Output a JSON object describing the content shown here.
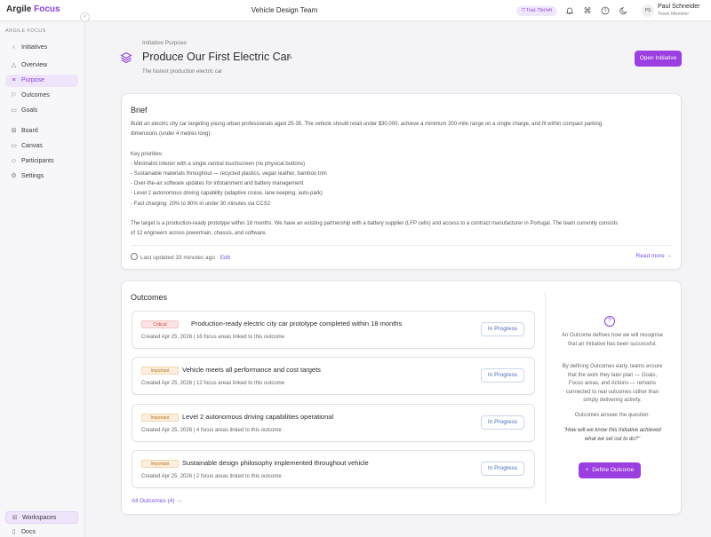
{
  "header": {
    "logo_main": "Argile",
    "logo_accent": "Focus",
    "team_title": "Vehicle Design Team",
    "trial_badge": "Trial: 79d left",
    "user_initials": "PS",
    "user_name": "Paul Schneider",
    "user_role": "Team Member"
  },
  "sidebar": {
    "heading": "ARGILE FOCUS",
    "back_label": "Initiatives",
    "items": [
      {
        "label": "Overview"
      },
      {
        "label": "Purpose"
      },
      {
        "label": "Outcomes"
      },
      {
        "label": "Goals"
      },
      {
        "label": "Board"
      },
      {
        "label": "Canvas"
      },
      {
        "label": "Participants"
      },
      {
        "label": "Settings"
      }
    ],
    "workspaces_label": "Workspaces",
    "docs_label": "Docs"
  },
  "page": {
    "crumb": "Initiative Purpose",
    "title": "Produce Our First Electric Car",
    "subtitle": "The fastest production electric car",
    "open_button": "Open Initiative"
  },
  "brief": {
    "title": "Brief",
    "lines": [
      "Build an electric city car targeting young urban professionals aged 25-35. The vehicle should retail under $30,000, achieve a minimum 200-mile range on a single charge, and fit within compact parking",
      "dimensions (under 4 metres long).",
      "",
      "Key priorities:",
      "- Minimalist interior with a single central touchscreen (no physical buttons)",
      "- Sustainable materials throughout — recycled plastics, vegan leather, bamboo trim",
      "- Over-the-air software updates for infotainment and battery management",
      "- Level 2 autonomous driving capability (adaptive cruise, lane keeping, auto-park)",
      "- Fast charging: 20% to 80% in under 30 minutes via CCS2",
      "",
      "The target is a production-ready prototype within 18 months. We have an existing partnership with a battery supplier (LFP cells) and access to a contract manufacturer in Portugal. The team currently consists",
      "of 12 engineers across powertrain, chassis, and software."
    ],
    "last_updated": "Last updated 33 minutes ago",
    "edit_label": "Edit",
    "read_more": "Read more →"
  },
  "outcomes": {
    "title": "Outcomes",
    "items": [
      {
        "priority": "Critical",
        "title": "Production-ready electric city car prototype completed within 18 months",
        "meta": "Created Apr 25, 2026  |  16 focus areas linked to this outcome",
        "status": "In Progress"
      },
      {
        "priority": "Important",
        "title": "Vehicle meets all performance and cost targets",
        "meta": "Created Apr 25, 2026  |  12 focus areas linked to this outcome",
        "status": "In Progress"
      },
      {
        "priority": "Important",
        "title": "Level 2 autonomous driving capabilities operational",
        "meta": "Created Apr 25, 2026  |  4 focus areas linked to this outcome",
        "status": "In Progress"
      },
      {
        "priority": "Important",
        "title": "Sustainable design philosophy implemented throughout vehicle",
        "meta": "Created Apr 25, 2026  |  2 focus areas linked to this outcome",
        "status": "In Progress"
      }
    ],
    "all_link": "All Outcomes (4) →",
    "side": {
      "para1": "An Outcome defines how we will recognise that an Initiative has been successful.",
      "para2": "By defining Outcomes early, teams ensure that the work they later plan — Goals, Focus areas, and Actions — remains connected to real outcomes rather than simply delivering activity.",
      "para3": "Outcomes answer the question:",
      "quote": "\"How will we know this Initiative achieved what we set out to do?\"",
      "button": "Define Outcome"
    }
  },
  "colors": {
    "accent": "#9b3fe0",
    "critical": "#c94b4b",
    "important": "#b8741f",
    "status": "#4a6bb8"
  }
}
